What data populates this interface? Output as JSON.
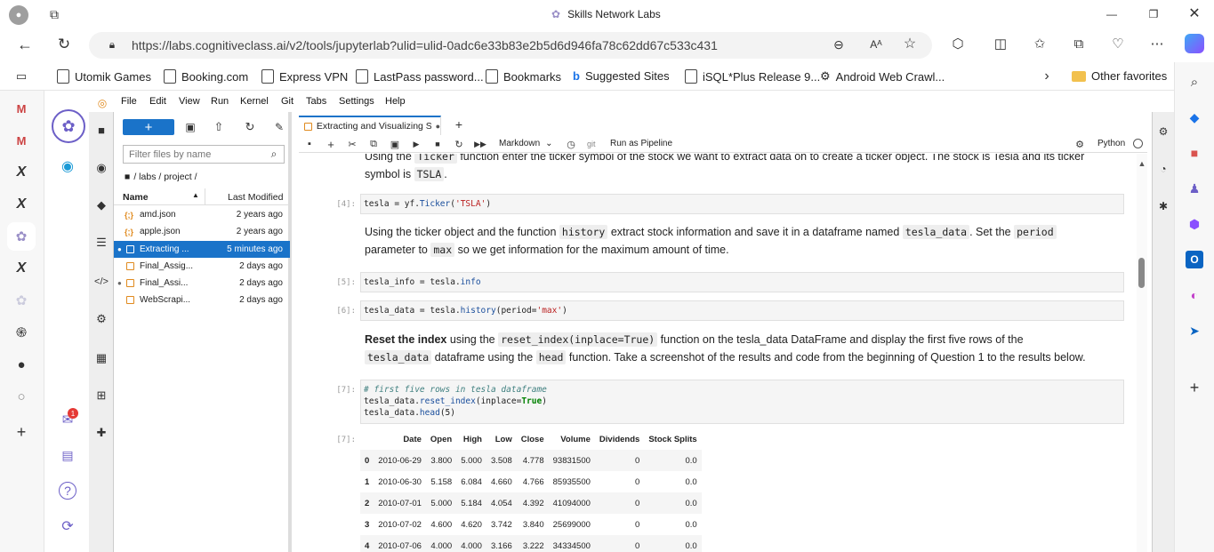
{
  "browser": {
    "title": "Skills Network Labs",
    "url": "https://labs.cognitiveclass.ai/v2/tools/jupyterlab?ulid=ulid-0adc6e33b83e2b5d6d946fa78c62dd67c533c431",
    "favorites": [
      "Utomik Games",
      "Booking.com",
      "Express VPN",
      "LastPass password...",
      "Bookmarks",
      "Suggested Sites",
      "iSQL*Plus Release 9...",
      "Android Web Crawl..."
    ],
    "other_favorites": "Other favorites",
    "notification_count": "1"
  },
  "jupyter": {
    "menu": [
      "File",
      "Edit",
      "View",
      "Run",
      "Kernel",
      "Git",
      "Tabs",
      "Settings",
      "Help"
    ],
    "filter_placeholder": "Filter files by name",
    "breadcrumb": "/ labs / project /",
    "col_name": "Name",
    "col_modified": "Last Modified",
    "files": [
      {
        "name": "amd.json",
        "modified": "2 years ago",
        "type": "json"
      },
      {
        "name": "apple.json",
        "modified": "2 years ago",
        "type": "json"
      },
      {
        "name": "Extracting ...",
        "modified": "5 minutes ago",
        "type": "notebook",
        "selected": true
      },
      {
        "name": "Final_Assig...",
        "modified": "2 days ago",
        "type": "notebook"
      },
      {
        "name": "Final_Assi...",
        "modified": "2 days ago",
        "type": "notebook"
      },
      {
        "name": "WebScrapi...",
        "modified": "2 days ago",
        "type": "notebook"
      }
    ],
    "tab_title": "Extracting and Visualizing St",
    "cell_type": "Markdown",
    "git_label": "git",
    "pipeline_label": "Run as Pipeline",
    "kernel": "Python"
  },
  "notebook": {
    "md1_part1": "Using the",
    "md1_code1": "Ticker",
    "md1_part2": "function enter the ticker symbol of the stock we want to extract data on to create a ticker object. The stock is Tesla and its ticker",
    "md1_part3": "symbol is",
    "md1_code2": "TSLA",
    "md1_part4": ".",
    "p4": "[4]:",
    "p5": "[5]:",
    "p6": "[6]:",
    "p7": "[7]:",
    "p7out": "[7]:",
    "md2_a": "Using the ticker object and the function",
    "md2_c1": "history",
    "md2_b": "extract stock information and save it in a dataframe named",
    "md2_c2": "tesla_data",
    "md2_c": ". Set the",
    "md2_c3": "period",
    "md2_d": "parameter to",
    "md2_c4": "max",
    "md2_e": "so we get information for the maximum amount of time.",
    "md3_bold": "Reset the index",
    "md3_a": "using the",
    "md3_c1": "reset_index(inplace=True)",
    "md3_b": "function on the tesla_data DataFrame and display the first five rows of the",
    "md3_c2": "tesla_data",
    "md3_c": "dataframe using the",
    "md3_c3": "head",
    "md3_d": "function. Take a screenshot of the results and code from the beginning of Question 1 to the results below.",
    "table": {
      "columns": [
        "Date",
        "Open",
        "High",
        "Low",
        "Close",
        "Volume",
        "Dividends",
        "Stock Splits"
      ],
      "rows": [
        [
          "0",
          "2010-06-29",
          "3.800",
          "5.000",
          "3.508",
          "4.778",
          "93831500",
          "0",
          "0.0"
        ],
        [
          "1",
          "2010-06-30",
          "5.158",
          "6.084",
          "4.660",
          "4.766",
          "85935500",
          "0",
          "0.0"
        ],
        [
          "2",
          "2010-07-01",
          "5.000",
          "5.184",
          "4.054",
          "4.392",
          "41094000",
          "0",
          "0.0"
        ],
        [
          "3",
          "2010-07-02",
          "4.600",
          "4.620",
          "3.742",
          "3.840",
          "25699000",
          "0",
          "0.0"
        ],
        [
          "4",
          "2010-07-06",
          "4.000",
          "4.000",
          "3.166",
          "3.222",
          "34334500",
          "0",
          "0.0"
        ]
      ]
    }
  }
}
